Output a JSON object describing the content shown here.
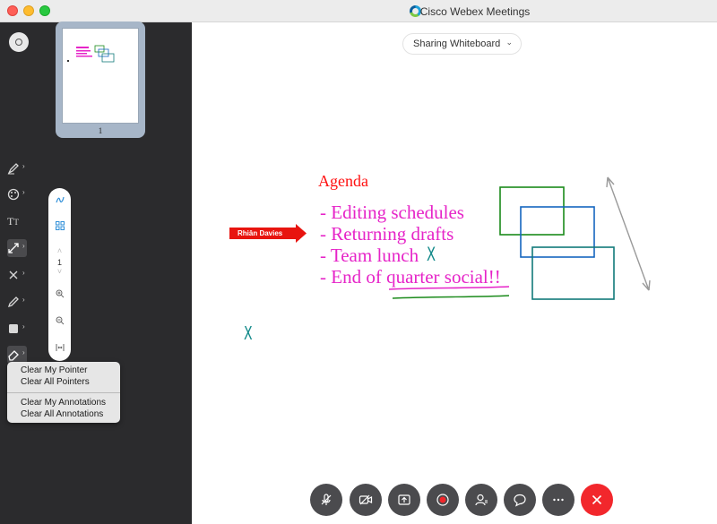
{
  "window": {
    "title": "Cisco Webex Meetings"
  },
  "thumbnail": {
    "page_number": "1"
  },
  "tools": [
    "annotate-icon",
    "pointer-color-icon",
    "text-icon",
    "arrow-icon",
    "clear-icon",
    "pen-icon",
    "shape-icon",
    "eraser-icon"
  ],
  "zoom_strip": {
    "page_value": "1"
  },
  "eraser_menu": {
    "items": [
      "Clear My Pointer",
      "Clear All Pointers",
      "Clear My Annotations",
      "Clear All Annotations"
    ]
  },
  "sharing": {
    "label": "Sharing Whiteboard"
  },
  "pointer": {
    "name": "Rhiân Davies"
  },
  "agenda": {
    "title": "Agenda",
    "lines": [
      "- Editing schedules",
      "- Returning drafts",
      "- Team lunch",
      "- End of quarter social!!"
    ],
    "check_mark": "X",
    "stray_mark": "X"
  },
  "colors": {
    "panel": "#2b2b2d",
    "agenda_title": "#ff1010",
    "agenda_text": "#e624c8",
    "pointer": "#e8140f",
    "end_call": "#f2272c"
  },
  "controls": [
    "mute-icon",
    "video-icon",
    "share-icon",
    "record-icon",
    "participants-icon",
    "chat-icon",
    "more-icon",
    "end-call-icon"
  ]
}
